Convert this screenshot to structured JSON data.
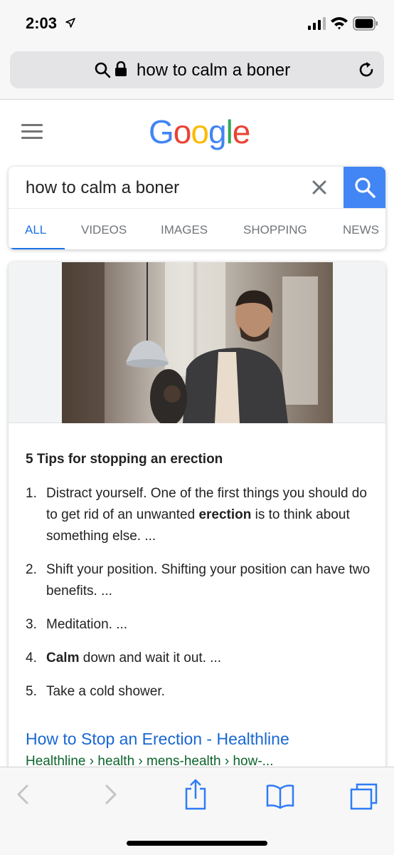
{
  "status_bar": {
    "time": "2:03"
  },
  "url_bar": {
    "text": "how to calm a boner"
  },
  "google": {
    "logo_letters": [
      {
        "char": "G",
        "color": "#4285F4"
      },
      {
        "char": "o",
        "color": "#EA4335"
      },
      {
        "char": "o",
        "color": "#FBBC05"
      },
      {
        "char": "g",
        "color": "#4285F4"
      },
      {
        "char": "l",
        "color": "#34A853"
      },
      {
        "char": "e",
        "color": "#EA4335"
      }
    ]
  },
  "search": {
    "query": "how to calm a boner",
    "tabs": [
      "ALL",
      "VIDEOS",
      "IMAGES",
      "SHOPPING",
      "NEWS"
    ],
    "active_tab": "ALL"
  },
  "result": {
    "snippet_title": "5 Tips for stopping an erection",
    "items": [
      {
        "num": "1.",
        "pre": "Distract yourself. One of the first things you should do to get rid of an unwanted ",
        "bold": "erection",
        "post": " is to think about something else. ..."
      },
      {
        "num": "2.",
        "pre": "Shift your position. Shifting your position can have two benefits. ...",
        "bold": "",
        "post": ""
      },
      {
        "num": "3.",
        "pre": "Meditation. ...",
        "bold": "",
        "post": ""
      },
      {
        "num": "4.",
        "pre": "",
        "bold": "Calm",
        "post": " down and wait it out. ..."
      },
      {
        "num": "5.",
        "pre": "Take a cold shower.",
        "bold": "",
        "post": ""
      }
    ],
    "link_title": "How to Stop an Erection - Healthline",
    "breadcrumb": "Healthline › health › mens-health › how-..."
  },
  "colors": {
    "accent": "#1a73e8",
    "search_button": "#4285f4",
    "link": "#1967d2",
    "url_green": "#0d652d"
  }
}
